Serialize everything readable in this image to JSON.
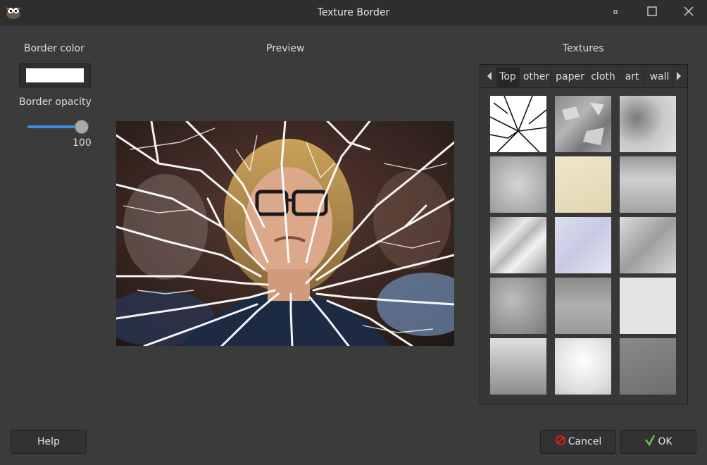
{
  "window": {
    "title": "Texture Border"
  },
  "left": {
    "border_color_label": "Border color",
    "border_color_value": "#ffffff",
    "border_opacity_label": "Border opacity",
    "border_opacity_value": "100"
  },
  "preview": {
    "label": "Preview"
  },
  "textures": {
    "label": "Textures",
    "tabs": [
      "Top",
      "other",
      "paper",
      "cloth",
      "art",
      "wall"
    ],
    "active_tab": "Top",
    "thumbnails": [
      "shattered-glass",
      "peeling-paint",
      "grey-grunge",
      "grey-paper",
      "beige-paper",
      "grey-scratched",
      "folded-paper",
      "wrinkled-paper",
      "crumpled-paper",
      "grey-concrete",
      "grey-stone",
      "light-grey-fabric",
      "stained-wall",
      "white-grunge",
      "grey-brushed"
    ]
  },
  "buttons": {
    "help": "Help",
    "cancel": "Cancel",
    "ok": "OK"
  },
  "colors": {
    "accent": "#3d8ee0",
    "cancel_icon": "#d42020",
    "ok_icon": "#6cc04a"
  }
}
